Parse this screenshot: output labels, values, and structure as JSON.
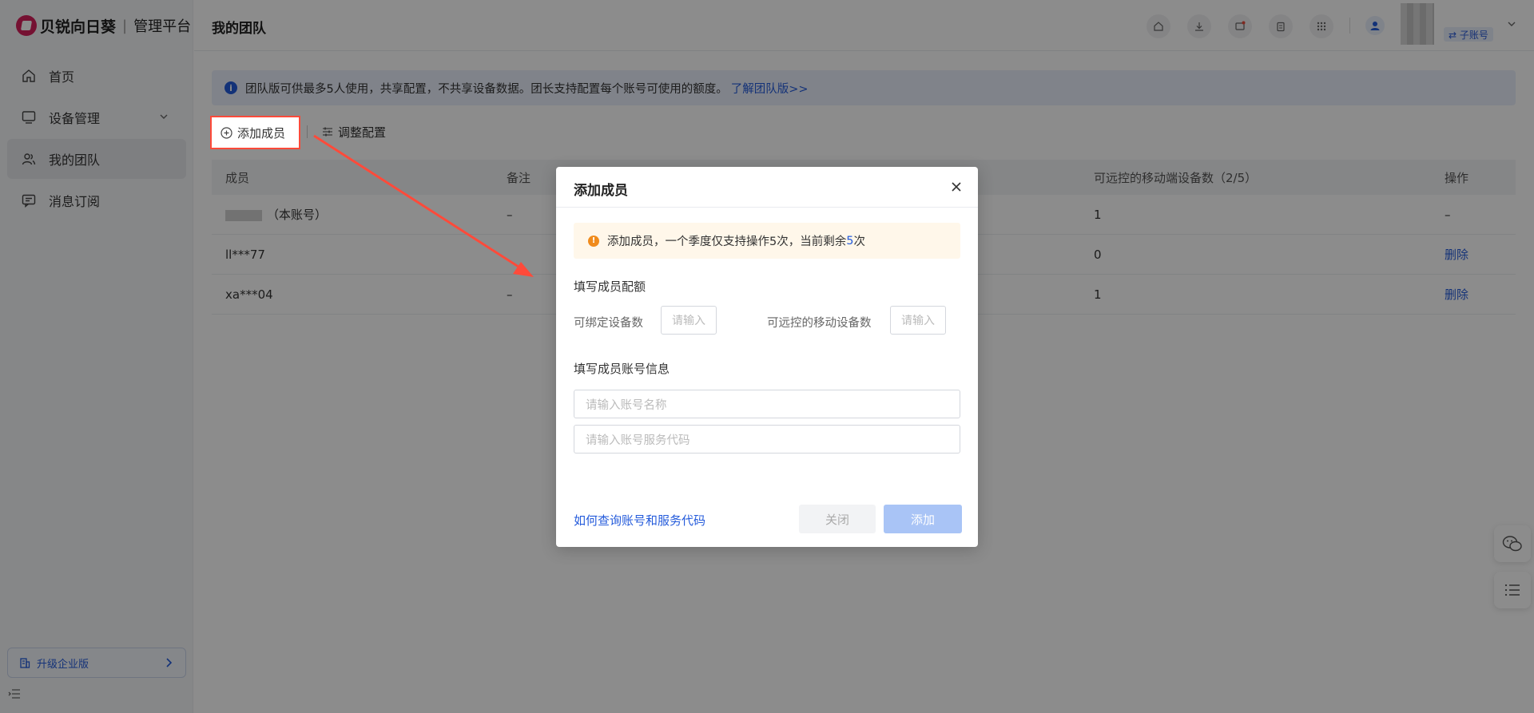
{
  "brand": {
    "name": "贝锐向日葵",
    "separator": "|",
    "subtitle": "管理平台"
  },
  "sidebar": {
    "items": [
      {
        "label": "首页",
        "icon": "home-icon"
      },
      {
        "label": "设备管理",
        "icon": "monitor-icon"
      },
      {
        "label": "我的团队",
        "icon": "team-icon"
      },
      {
        "label": "消息订阅",
        "icon": "message-icon"
      }
    ],
    "upgrade_label": "升级企业版"
  },
  "header": {
    "title": "我的团队",
    "sub_account_label": "⇄ 子账号"
  },
  "banner": {
    "text": "团队版可供最多5人使用，共享配置，不共享设备数据。团长支持配置每个账号可使用的额度。",
    "link": "了解团队版>>"
  },
  "toolbar": {
    "add_member": "添加成员",
    "adjust_config": "调整配置"
  },
  "table": {
    "columns": [
      "成员",
      "备注",
      "可远控的移动端设备数（2/5）",
      "操作"
    ],
    "rows": [
      {
        "member": "（本账号）",
        "remark": "–",
        "mobile": "1",
        "action": "–"
      },
      {
        "member": "ll***77",
        "remark": "",
        "mobile": "0",
        "action": "删除"
      },
      {
        "member": "xa***04",
        "remark": "–",
        "mobile": "1",
        "action": "删除"
      }
    ]
  },
  "dialog": {
    "title": "添加成员",
    "warning_prefix": "添加成员，一个季度仅支持操作5次，当前剩余",
    "warning_count": "5",
    "warning_suffix": "次",
    "quota_section": "填写成员配额",
    "bind_label": "可绑定设备数",
    "bind_placeholder": "请输入",
    "mobile_label": "可远控的移动设备数",
    "mobile_placeholder": "请输入",
    "account_section": "填写成员账号信息",
    "account_name_placeholder": "请输入账号名称",
    "service_code_placeholder": "请输入账号服务代码",
    "help_link": "如何查询账号和服务代码",
    "close_label": "关闭",
    "add_label": "添加"
  },
  "colors": {
    "accent": "#245bdb",
    "highlight": "#ff4a3a",
    "warning": "#f08b1c",
    "brand": "#d6205c"
  }
}
